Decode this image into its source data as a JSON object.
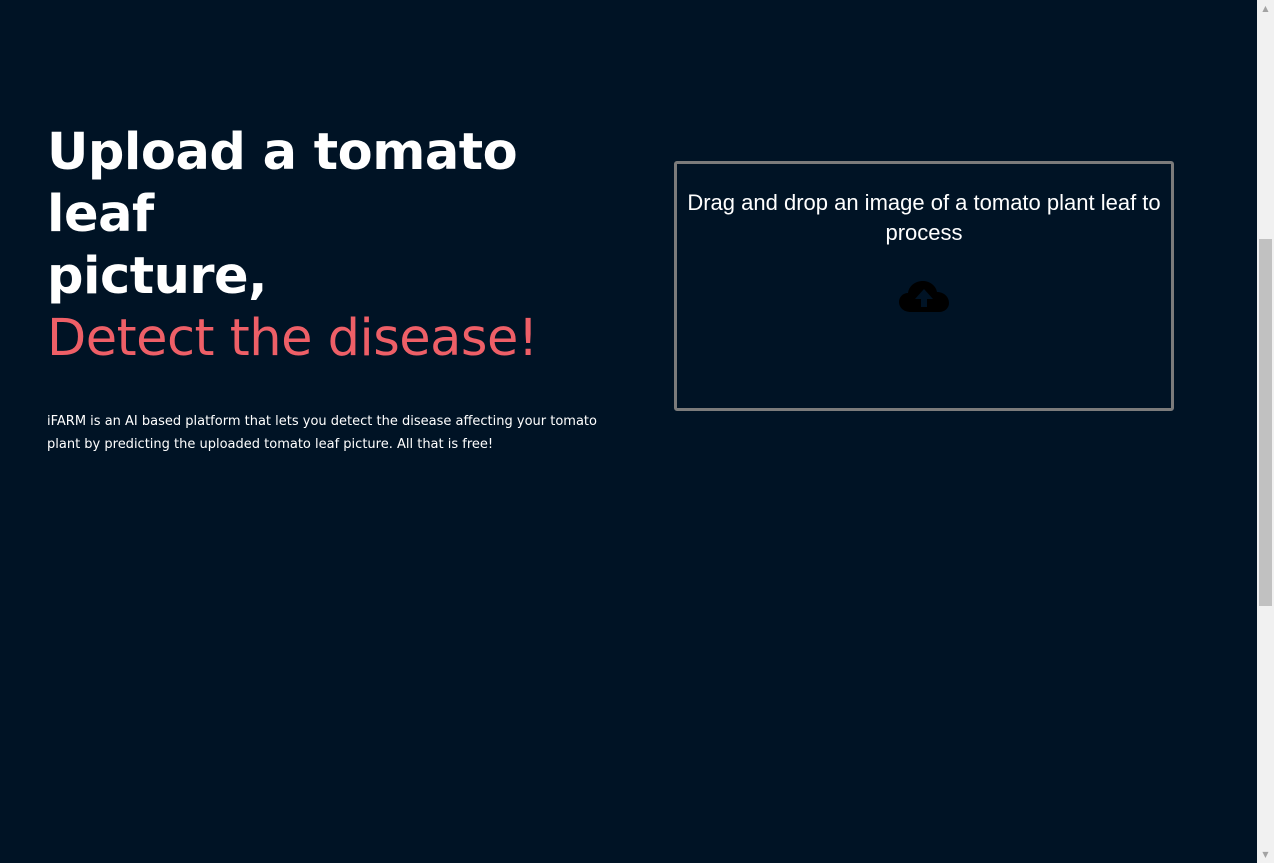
{
  "hero": {
    "title_line1": "Upload a tomato leaf",
    "title_line2": "picture,",
    "title_accent": "Detect the disease!",
    "description": "iFARM is an AI based platform that lets you detect the disease affecting your tomato plant by predicting the uploaded tomato leaf picture. All that is free!"
  },
  "dropzone": {
    "label": "Drag and drop an image of a tomato plant leaf to process",
    "icon": "cloud-upload-icon"
  },
  "colors": {
    "background": "#001325",
    "accent": "#ee5f67",
    "text": "#ffffff",
    "dropzone_border": "#7b7b7b"
  },
  "scrollbar": {
    "up_arrow": "▲",
    "down_arrow": "▼"
  }
}
